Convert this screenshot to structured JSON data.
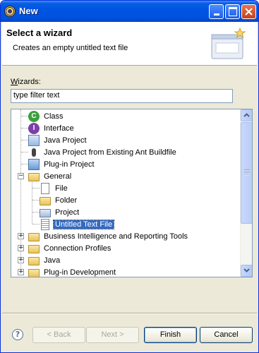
{
  "window": {
    "title": "New"
  },
  "header": {
    "title": "Select a wizard",
    "description": "Creates an empty untitled text file"
  },
  "wizards": {
    "label_mnemonic": "W",
    "label_rest": "izards:",
    "filter_value": "type filter text"
  },
  "tree": {
    "items": [
      {
        "label": "Class",
        "icon": "class-icon"
      },
      {
        "label": "Interface",
        "icon": "interface-icon"
      },
      {
        "label": "Java Project",
        "icon": "java-project-icon"
      },
      {
        "label": "Java Project from Existing Ant Buildfile",
        "icon": "ant-icon"
      },
      {
        "label": "Plug-in Project",
        "icon": "plugin-project-icon"
      },
      {
        "label": "General",
        "icon": "folder-open-icon",
        "expanded": true
      },
      {
        "label": "File",
        "icon": "file-icon"
      },
      {
        "label": "Folder",
        "icon": "folder-icon"
      },
      {
        "label": "Project",
        "icon": "project-icon"
      },
      {
        "label": "Untitled Text File",
        "icon": "text-file-icon",
        "selected": true
      },
      {
        "label": "Business Intelligence and Reporting Tools",
        "icon": "folder-icon",
        "expanded": false
      },
      {
        "label": "Connection Profiles",
        "icon": "folder-icon",
        "expanded": false
      },
      {
        "label": "Java",
        "icon": "folder-icon",
        "expanded": false
      },
      {
        "label": "Plug-in Development",
        "icon": "folder-icon",
        "expanded": false
      }
    ]
  },
  "buttons": {
    "back": "< Back",
    "next": "Next >",
    "finish": "Finish",
    "cancel": "Cancel"
  }
}
